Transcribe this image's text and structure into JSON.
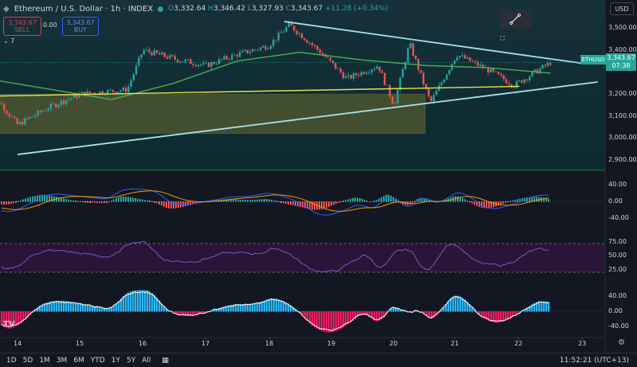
{
  "header": {
    "symbol": "Ethereum / U.S. Dollar · 1h · INDEX",
    "open": "3,332.64",
    "high": "3,346.42",
    "low": "3,327.93",
    "close": "3,343.67",
    "change": "+11.28 (+0.34%)"
  },
  "trade": {
    "sell_price": "3,343.67",
    "sell_label": "SELL",
    "spread": "0.00",
    "buy_price": "3,343.67",
    "buy_label": "BUY"
  },
  "indicator_count": "7",
  "currency": "USD",
  "price_tag": {
    "symbol": "ETHUSD",
    "price": "3,343.67",
    "countdown": "07:38"
  },
  "price_axis": [
    "3,500.00",
    "3,400.00",
    "3,300.00",
    "3,200.00",
    "3,100.00",
    "3,000.00",
    "2,900.00"
  ],
  "macd_axis": [
    "40.00",
    "0.00",
    "-40.00"
  ],
  "rsi_axis": [
    "75.00",
    "50.00",
    "25.00"
  ],
  "osc_axis": [
    "40.00",
    "0.00",
    "-40.00"
  ],
  "time_axis": [
    "14",
    "15",
    "16",
    "17",
    "18",
    "19",
    "20",
    "21",
    "22",
    "23"
  ],
  "timeframes": [
    "1D",
    "5D",
    "1M",
    "3M",
    "6M",
    "YTD",
    "1Y",
    "5Y",
    "All"
  ],
  "clock": "11:52:21 (UTC+13)",
  "logo": "TV",
  "colors": {
    "up": "#26a69a",
    "down": "#ef5350",
    "bg": "#131722",
    "accent": "#2962ff"
  },
  "chart_data": {
    "type": "candlestick",
    "y_range": [
      2860,
      3570
    ],
    "x_range": [
      "13 Dec 12:00",
      "23 Dec 00:00"
    ],
    "last_price": 3343.67,
    "candles_approx_close_path": [
      {
        "t": "13 Dec 12:00",
        "price": 3240
      },
      {
        "t": "14 Dec 00:00",
        "price": 3060
      },
      {
        "t": "14 Dec 12:00",
        "price": 3140
      },
      {
        "t": "15 Dec 00:00",
        "price": 3200
      },
      {
        "t": "15 Dec 18:00",
        "price": 3220
      },
      {
        "t": "16 Dec 00:00",
        "price": 3400
      },
      {
        "t": "16 Dec 12:00",
        "price": 3360
      },
      {
        "t": "17 Dec 00:00",
        "price": 3330
      },
      {
        "t": "17 Dec 12:00",
        "price": 3380
      },
      {
        "t": "18 Dec 00:00",
        "price": 3420
      },
      {
        "t": "18 Dec 08:00",
        "price": 3515
      },
      {
        "t": "18 Dec 20:00",
        "price": 3390
      },
      {
        "t": "19 Dec 06:00",
        "price": 3270
      },
      {
        "t": "19 Dec 18:00",
        "price": 3330
      },
      {
        "t": "20 Dec 00:00",
        "price": 3150
      },
      {
        "t": "20 Dec 06:00",
        "price": 3430
      },
      {
        "t": "20 Dec 14:00",
        "price": 3160
      },
      {
        "t": "21 Dec 00:00",
        "price": 3380
      },
      {
        "t": "21 Dec 12:00",
        "price": 3310
      },
      {
        "t": "21 Dec 22:00",
        "price": 3240
      },
      {
        "t": "22 Dec 12:00",
        "price": 3343.67
      }
    ],
    "ma_line": [
      {
        "t": "13 Dec 12:00",
        "price": 3270
      },
      {
        "t": "15 Dec 12:00",
        "price": 3175
      },
      {
        "t": "16 Dec 12:00",
        "price": 3250
      },
      {
        "t": "17 Dec 12:00",
        "price": 3350
      },
      {
        "t": "18 Dec 12:00",
        "price": 3390
      },
      {
        "t": "19 Dec 12:00",
        "price": 3355
      },
      {
        "t": "20 Dec 12:00",
        "price": 3330
      },
      {
        "t": "21 Dec 12:00",
        "price": 3320
      },
      {
        "t": "22 Dec 12:00",
        "price": 3295
      }
    ],
    "drawings": {
      "upper_trendline": [
        {
          "t": "18 Dec 06:00",
          "price": 3530
        },
        {
          "t": "23 Dec 00:00",
          "price": 3340
        }
      ],
      "lower_trendline": [
        {
          "t": "14 Dec 00:00",
          "price": 2925
        },
        {
          "t": "23 Dec 06:00",
          "price": 3255
        }
      ],
      "support_line": [
        {
          "t": "13 Dec 12:00",
          "price": 3190
        },
        {
          "t": "22 Dec 00:00",
          "price": 3235
        }
      ],
      "zone": {
        "from": "13 Dec 12:00",
        "to": "20 Dec 12:00",
        "top": 3200,
        "bottom": 3020
      }
    },
    "macd_range": [
      -60,
      60
    ],
    "rsi_levels": [
      70,
      30
    ],
    "rsi_range": [
      10,
      90
    ],
    "osc_range": [
      -60,
      60
    ]
  }
}
